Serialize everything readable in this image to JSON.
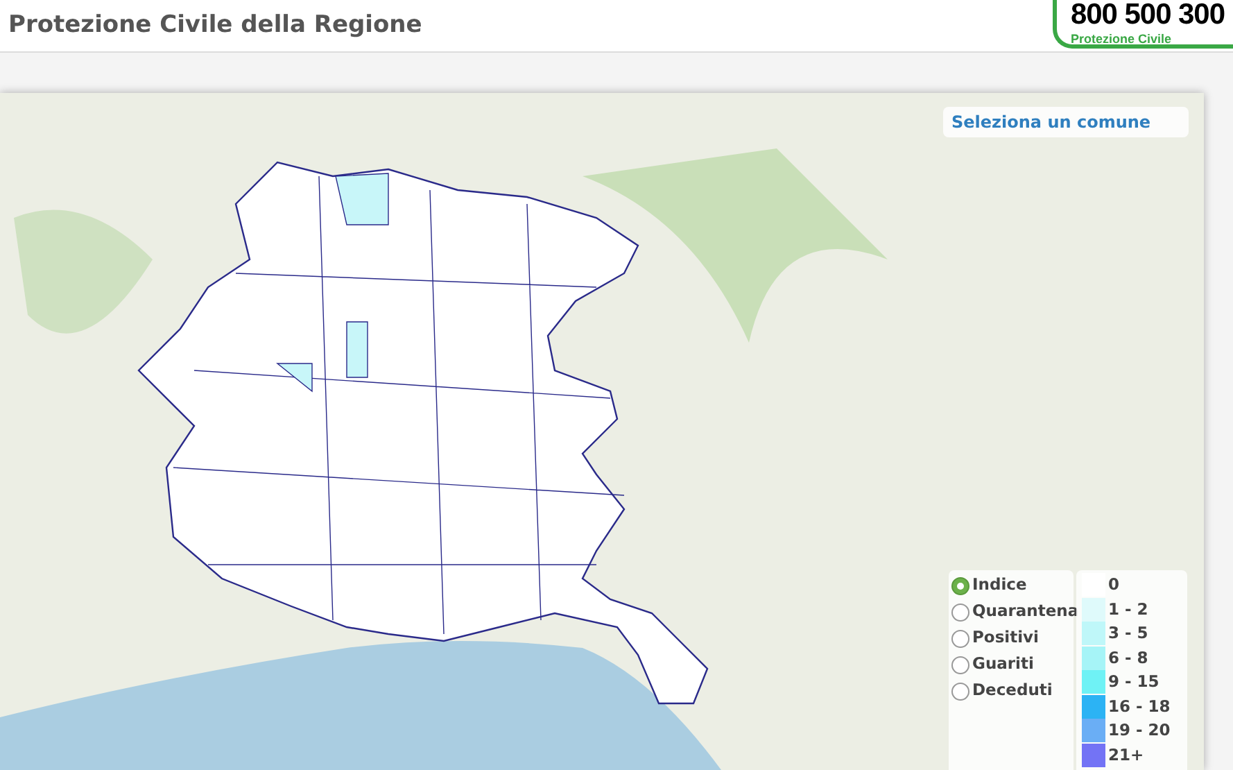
{
  "header": {
    "title": "Protezione Civile della Regione",
    "hotline": {
      "number": "800 500 300",
      "caption": "Protezione Civile"
    }
  },
  "map": {
    "search_label": "Seleziona un comune",
    "layers": [
      {
        "label": "Indice",
        "selected": true
      },
      {
        "label": "Quarantena",
        "selected": false
      },
      {
        "label": "Positivi",
        "selected": false
      },
      {
        "label": "Guariti",
        "selected": false
      },
      {
        "label": "Deceduti",
        "selected": false
      }
    ],
    "legend": [
      {
        "label": "0",
        "color": "#ffffff"
      },
      {
        "label": "1 - 2",
        "color": "#dffafb"
      },
      {
        "label": "3 - 5",
        "color": "#bff7f9"
      },
      {
        "label": "6 - 8",
        "color": "#a6f4f7"
      },
      {
        "label": "9 - 15",
        "color": "#6ff2f5"
      },
      {
        "label": "16 - 18",
        "color": "#2cb3f4"
      },
      {
        "label": "19 - 20",
        "color": "#6aaef5"
      },
      {
        "label": "21+",
        "color": "#7373f5"
      }
    ]
  }
}
